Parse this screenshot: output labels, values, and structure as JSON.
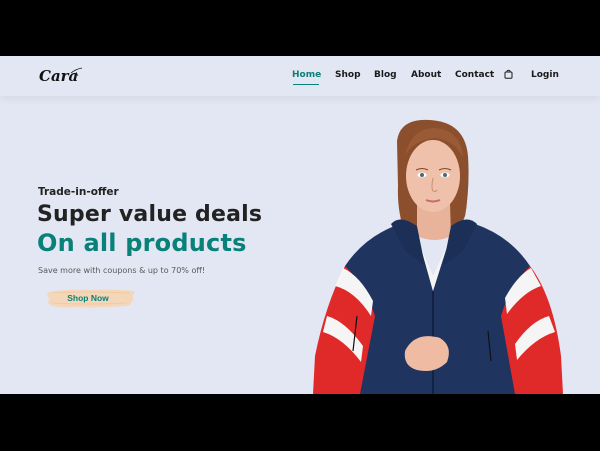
{
  "header": {
    "logo_text": "Cara",
    "nav": [
      {
        "label": "Home",
        "active": true
      },
      {
        "label": "Shop"
      },
      {
        "label": "Blog"
      },
      {
        "label": "About"
      },
      {
        "label": "Contact"
      },
      {
        "icon": "shopping-bag-icon"
      },
      {
        "label": "Login"
      }
    ]
  },
  "hero": {
    "subtitle": "Trade-in-offer",
    "heading_line1": "Super value deals",
    "heading_line2": "On all products",
    "description": "Save more with coupons & up to 70% off!",
    "button_label": "Shop Now",
    "image": "model-in-red-white-navy-jacket"
  },
  "colors": {
    "background": "#e3e6f3",
    "accent": "#088178",
    "text_dark": "#222222",
    "button_bg": "#f4d7b8"
  }
}
